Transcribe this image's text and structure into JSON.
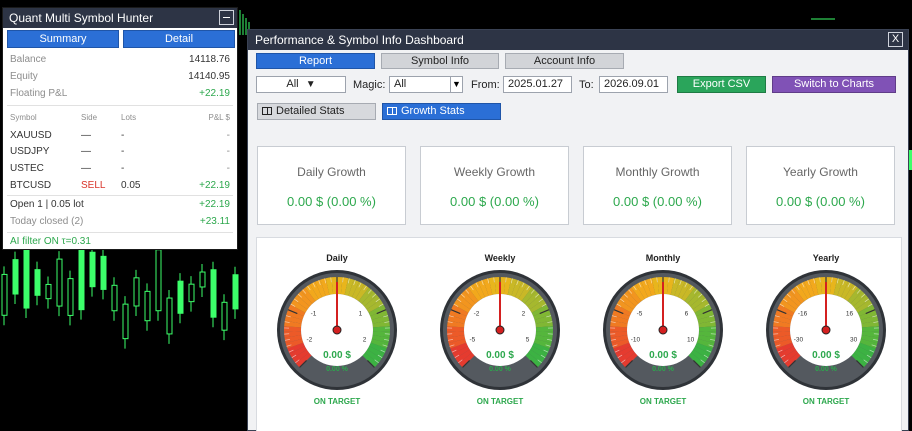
{
  "summary_panel": {
    "title": "Quant Multi Symbol Hunter",
    "tabs": [
      "Summary",
      "Detail"
    ],
    "balance": {
      "label": "Balance",
      "value": "14118.76"
    },
    "equity": {
      "label": "Equity",
      "value": "14140.95"
    },
    "floating": {
      "label": "Floating P&L",
      "value": "+22.19"
    },
    "columns": {
      "symbol": "Symbol",
      "side": "Side",
      "lots": "Lots",
      "pnl": "P&L $"
    },
    "rows": [
      {
        "symbol": "XAUUSD",
        "side": "—",
        "lots": "-",
        "pnl": "-"
      },
      {
        "symbol": "USDJPY",
        "side": "—",
        "lots": "-",
        "pnl": "-"
      },
      {
        "symbol": "USTEC",
        "side": "—",
        "lots": "-",
        "pnl": "-"
      },
      {
        "symbol": "BTCUSD",
        "side": "SELL",
        "lots": "0.05",
        "pnl": "+22.19"
      }
    ],
    "open_summary": {
      "label": "Open 1 | 0.05 lot",
      "value": "+22.19"
    },
    "today_closed": {
      "label": "Today closed (2)",
      "value": "+23.11"
    },
    "ai_filter": "AI filter ON  τ=0.31",
    "colors": {
      "positive": "#2da84d",
      "sell": "#d9342a",
      "header": "#2d3445",
      "tab": "#2b6fd6"
    }
  },
  "dashboard": {
    "title": "Performance & Symbol Info Dashboard",
    "close_label": "X",
    "tabs": [
      "Report",
      "Symbol Info",
      "Account Info"
    ],
    "active_tab": "Report",
    "filters": {
      "symbol_select": "All",
      "magic_label": "Magic:",
      "magic_value": "All",
      "from_label": "From:",
      "from_value": "2025.01.27",
      "to_label": "To:",
      "to_value": "2026.09.01"
    },
    "buttons": {
      "export": "Export CSV",
      "switch": "Switch to Charts"
    },
    "stats_tabs": [
      "Detailed Stats",
      "Growth Stats"
    ],
    "active_stats_tab": "Growth Stats",
    "cards": [
      {
        "title": "Daily Growth",
        "value": "0.00 $ (0.00 %)"
      },
      {
        "title": "Weekly Growth",
        "value": "0.00 $ (0.00 %)"
      },
      {
        "title": "Monthly Growth",
        "value": "0.00 $ (0.00 %)"
      },
      {
        "title": "Yearly Growth",
        "value": "0.00 $ (0.00 %)"
      }
    ],
    "gauges": [
      {
        "title": "Daily",
        "ticks": [
          "-2",
          "-1",
          "1",
          "2"
        ],
        "value": "0.00 $",
        "percent": "0.00 %",
        "status": "ON TARGET",
        "level": 0
      },
      {
        "title": "Weekly",
        "ticks": [
          "-5",
          "-2",
          "2",
          "5"
        ],
        "value": "0.00 $",
        "percent": "0.00 %",
        "status": "ON TARGET",
        "level": 0
      },
      {
        "title": "Monthly",
        "ticks": [
          "-10",
          "-5",
          "6",
          "10"
        ],
        "value": "0.00 $",
        "percent": "0.00 %",
        "status": "ON TARGET",
        "level": 0
      },
      {
        "title": "Yearly",
        "ticks": [
          "-30",
          "-16",
          "16",
          "30"
        ],
        "value": "0.00 $",
        "percent": "0.00 %",
        "status": "ON TARGET",
        "level": 0
      }
    ]
  }
}
